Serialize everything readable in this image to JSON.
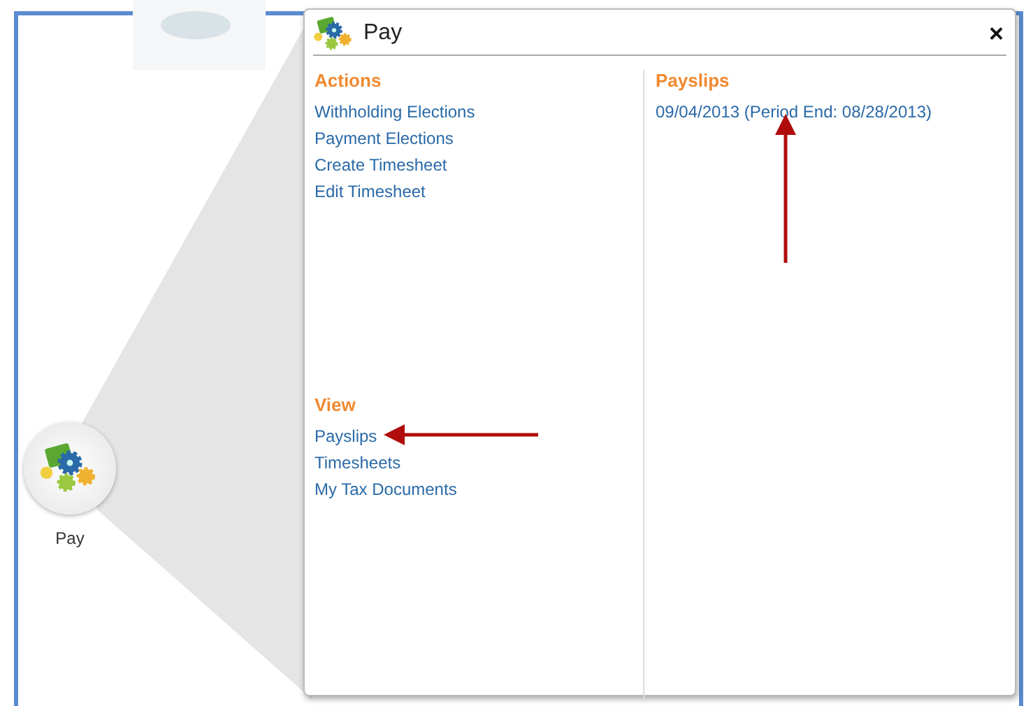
{
  "app_tile": {
    "label": "Pay"
  },
  "popup": {
    "title": "Pay",
    "close": "×",
    "left_column": {
      "sections": [
        {
          "heading": "Actions",
          "links": [
            "Withholding Elections",
            "Payment Elections",
            "Create Timesheet",
            "Edit Timesheet"
          ]
        },
        {
          "heading": "View",
          "links": [
            "Payslips",
            "Timesheets",
            "My Tax Documents"
          ]
        }
      ]
    },
    "right_column": {
      "sections": [
        {
          "heading": "Payslips",
          "links": [
            "09/04/2013 (Period End: 08/28/2013)"
          ]
        }
      ]
    }
  }
}
